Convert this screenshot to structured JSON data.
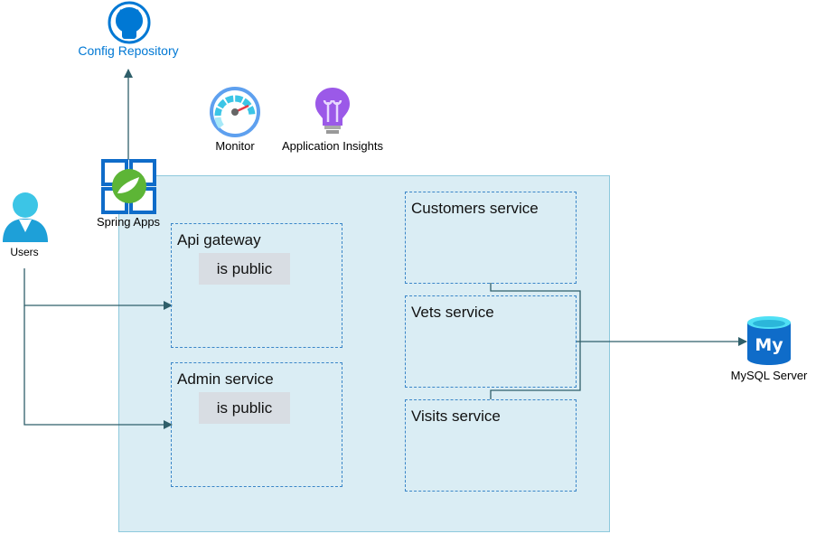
{
  "nodes": {
    "config_repository": {
      "label": "Config Repository",
      "icon": "github-icon",
      "color": "#0078d4"
    },
    "monitor": {
      "label": "Monitor",
      "icon": "monitor-gauge-icon"
    },
    "application_insights": {
      "label": "Application Insights",
      "icon": "lightbulb-icon"
    },
    "spring_apps": {
      "label": "Spring Apps",
      "icon": "spring-apps-icon"
    },
    "users": {
      "label": "Users",
      "icon": "user-icon"
    },
    "mysql": {
      "label": "MySQL Server",
      "icon": "mysql-database-icon",
      "glyph": "My"
    }
  },
  "services": {
    "api_gateway": {
      "title": "Api gateway",
      "tag": "is public"
    },
    "admin_service": {
      "title": "Admin service",
      "tag": "is public"
    },
    "customers_service": {
      "title": "Customers service"
    },
    "vets_service": {
      "title": "Vets service"
    },
    "visits_service": {
      "title": "Visits service"
    }
  },
  "colors": {
    "container_fill": "#daedf4",
    "container_border": "#8ec9dc",
    "dashed_border": "#3a86c8",
    "connector": "#2f5f6a"
  }
}
